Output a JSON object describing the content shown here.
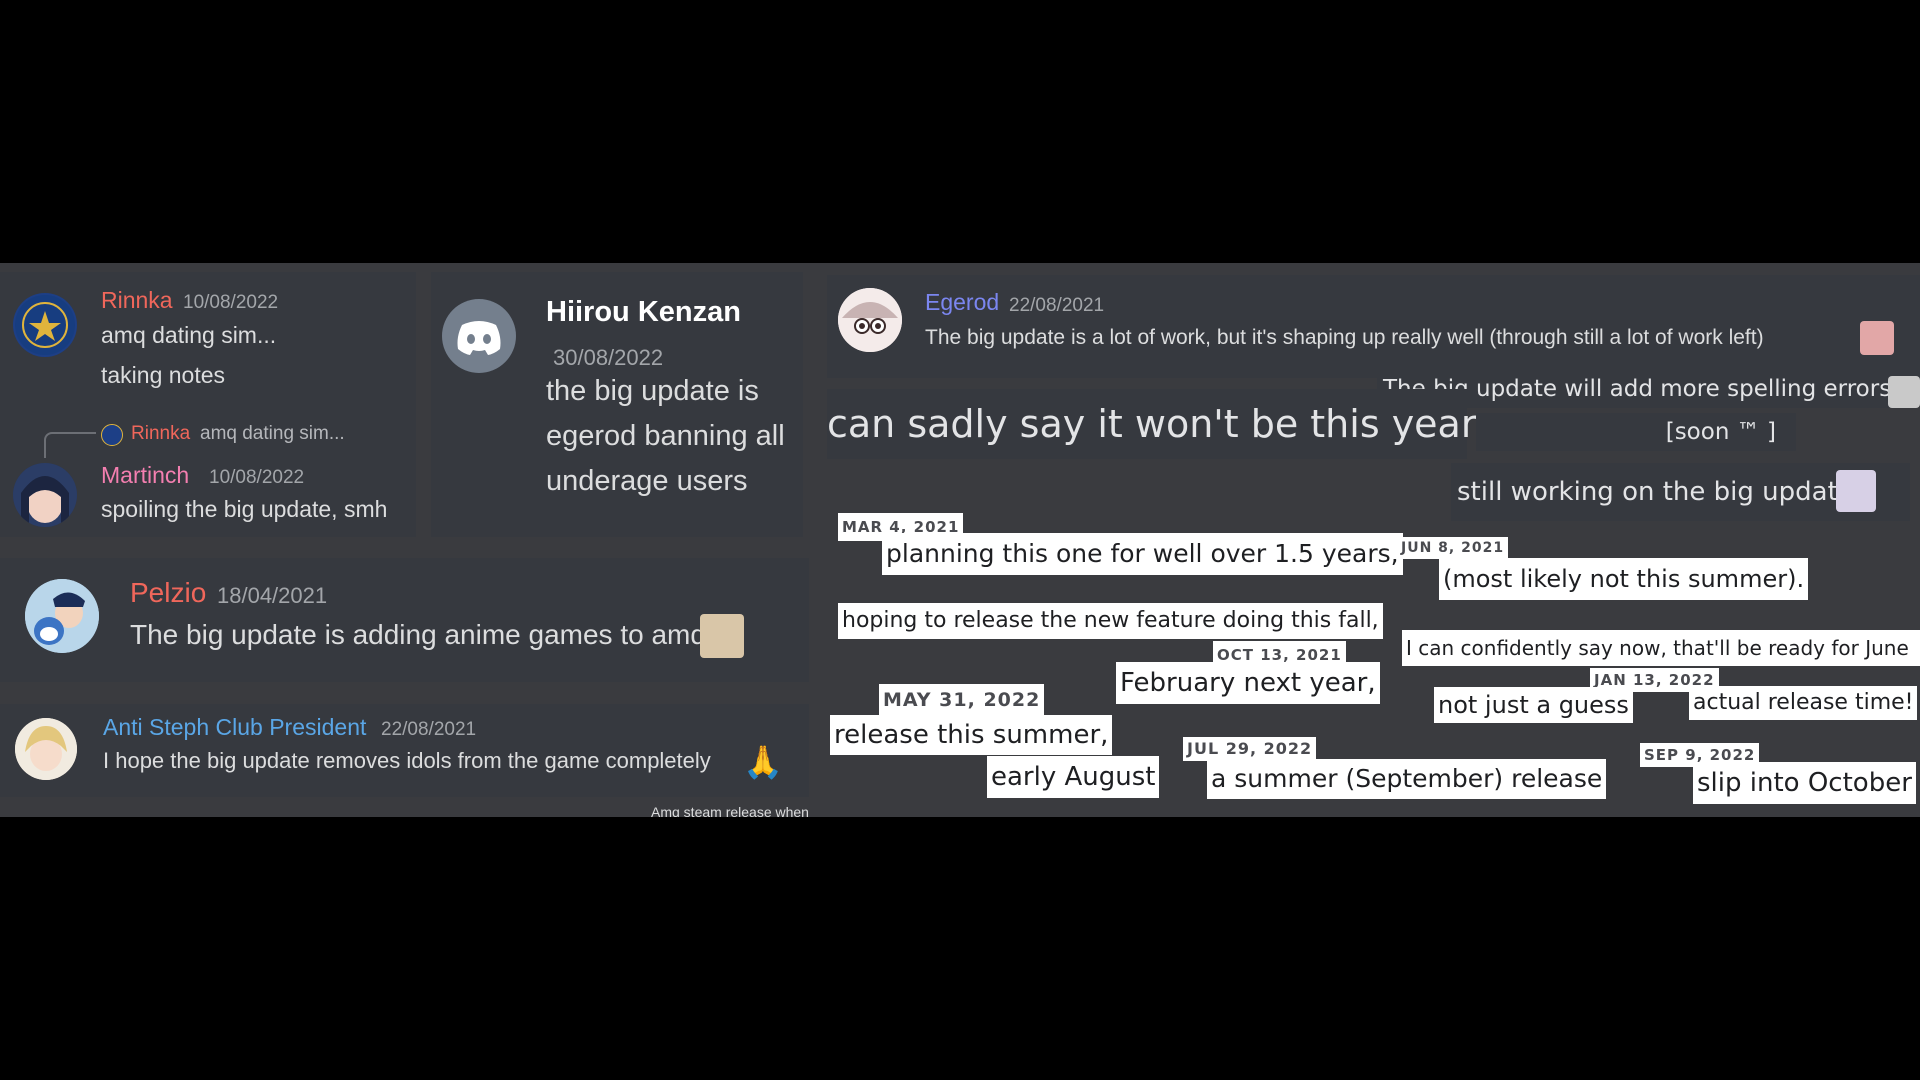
{
  "rinnka_card": {
    "name": "Rinnka",
    "time": "10/08/2022",
    "lines": [
      "amq dating sim...",
      "taking notes"
    ],
    "name_color": "#f0675b",
    "avatar_seal_text": "ATE OF OREG 1859"
  },
  "martinch_card": {
    "reply_name": "Rinnka",
    "reply_text": "amq dating sim...",
    "name": "Martinch",
    "time": "10/08/2022",
    "text": "spoiling the big update, smh",
    "name_color": "#f47fb0"
  },
  "hiirou_card": {
    "name": "Hiirou Kenzan",
    "time": "30/08/2022",
    "lines": [
      "the big update is",
      "egerod banning all",
      "underage users"
    ]
  },
  "pelzio_card": {
    "name": "Pelzio",
    "time": "18/04/2021",
    "text": "The big update is adding anime games to amq",
    "name_color": "#f0675b"
  },
  "anti_card": {
    "name": "Anti Steph Club President",
    "time": "22/08/2021",
    "text": "I hope the big update removes idols from the game completely",
    "emoji": "🙏",
    "name_color": "#5aa6e6",
    "cutoff_text": "Amq steam release when"
  },
  "egerod_card": {
    "name": "Egerod",
    "time": "22/08/2021",
    "text": "The big update is a lot of work, but it's shaping up really well (through still a lot of work left)",
    "name_color": "#7b86f0"
  },
  "discord_cutouts": {
    "spelling": "The big update will add more spelling errors",
    "sadly": "can sadly say it won't be this year,",
    "soon": "[soon ™ ]",
    "still": "still working on the big update"
  },
  "clippings": {
    "d_mar4": "MAR 4, 2021",
    "planning": "planning this one for well over 1.5 years,",
    "d_jun8": "JUN 8, 2021",
    "summer_unlikely": "(most likely not this summer).",
    "hoping": "hoping to release the new feature doing this fall,",
    "d_oct13": "OCT 13, 2021",
    "confident": "I can confidently say now, that'll be ready for June",
    "february": "February next year,",
    "d_jan13": "JAN 13, 2022",
    "guess": "not just a guess",
    "actual": "actual release time!",
    "d_may31": "MAY 31, 2022",
    "release_summer": "release this summer,",
    "early_aug": "early August",
    "d_jul29": "JUL 29, 2022",
    "september": "a summer (September) release",
    "d_sep9": "SEP 9, 2022",
    "october": "slip into October"
  }
}
